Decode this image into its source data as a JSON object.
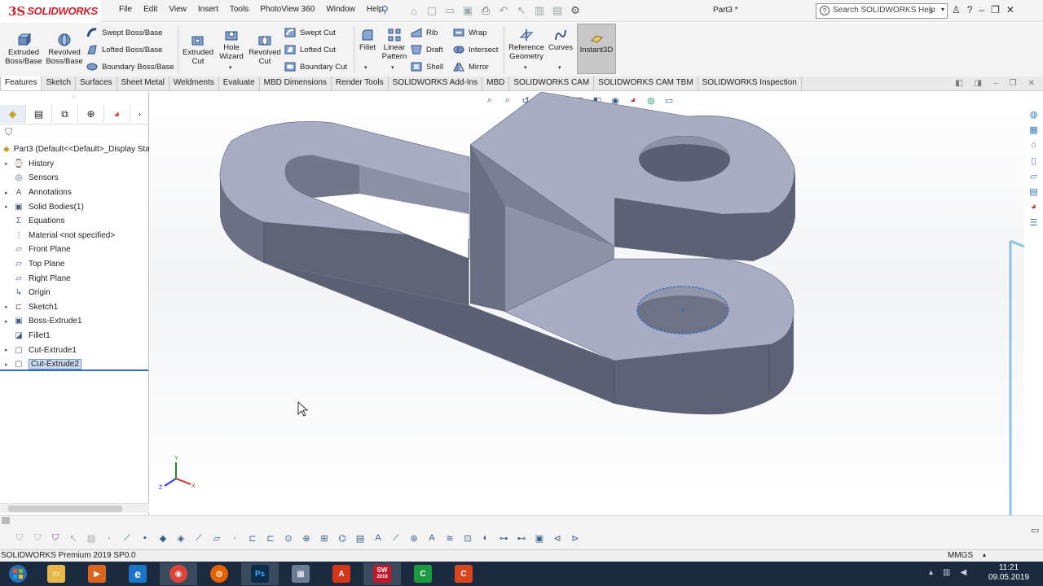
{
  "app": {
    "brand_prefix": "3S",
    "brand": "SOLIDWORKS",
    "doc_title": "Part3 *"
  },
  "menu": [
    "File",
    "Edit",
    "View",
    "Insert",
    "Tools",
    "PhotoView 360",
    "Window",
    "Help"
  ],
  "search": {
    "placeholder": "Search SOLIDWORKS Help"
  },
  "ribbon": {
    "extruded_boss": "Extruded Boss/Base",
    "revolved_boss": "Revolved Boss/Base",
    "swept_boss": "Swept Boss/Base",
    "lofted_boss": "Lofted Boss/Base",
    "boundary_boss": "Boundary Boss/Base",
    "extruded_cut": "Extruded Cut",
    "hole_wizard": "Hole Wizard",
    "revolved_cut": "Revolved Cut",
    "swept_cut": "Swept Cut",
    "lofted_cut": "Lofted Cut",
    "boundary_cut": "Boundary Cut",
    "fillet": "Fillet",
    "linear_pattern": "Linear Pattern",
    "rib": "Rib",
    "draft": "Draft",
    "shell": "Shell",
    "wrap": "Wrap",
    "intersect": "Intersect",
    "mirror": "Mirror",
    "reference_geometry": "Reference Geometry",
    "curves": "Curves",
    "instant3d": "Instant3D"
  },
  "tabs": [
    "Features",
    "Sketch",
    "Surfaces",
    "Sheet Metal",
    "Weldments",
    "Evaluate",
    "MBD Dimensions",
    "Render Tools",
    "SOLIDWORKS Add-Ins",
    "MBD",
    "SOLIDWORKS CAM",
    "SOLIDWORKS CAM TBM",
    "SOLIDWORKS Inspection"
  ],
  "active_tab": "Features",
  "tree": {
    "root": "Part3  (Default<<Default>_Display Sta",
    "items": [
      {
        "label": "History",
        "expandable": true
      },
      {
        "label": "Sensors",
        "expandable": false
      },
      {
        "label": "Annotations",
        "expandable": true
      },
      {
        "label": "Solid Bodies(1)",
        "expandable": true
      },
      {
        "label": "Equations",
        "expandable": false
      },
      {
        "label": "Material <not specified>",
        "expandable": false
      },
      {
        "label": "Front Plane",
        "expandable": false
      },
      {
        "label": "Top Plane",
        "expandable": false
      },
      {
        "label": "Right Plane",
        "expandable": false
      },
      {
        "label": "Origin",
        "expandable": false
      },
      {
        "label": "Sketch1",
        "expandable": true
      },
      {
        "label": "Boss-Extrude1",
        "expandable": true
      },
      {
        "label": "Fillet1",
        "expandable": false
      },
      {
        "label": "Cut-Extrude1",
        "expandable": true
      },
      {
        "label": "Cut-Extrude2",
        "expandable": true,
        "selected": true
      }
    ]
  },
  "axes": {
    "x": "X",
    "y": "Y",
    "z": "Z"
  },
  "status": {
    "version": "SOLIDWORKS Premium 2019 SP0.0",
    "units": "MMGS"
  },
  "taskbar": {
    "time": "11:21",
    "date": "09.05.2019",
    "sw_badge": "SW",
    "sw_year": "2019"
  },
  "colors": {
    "part_face": "#a8acc0",
    "part_side": "#5a5e72",
    "selection": "#2d6ebf",
    "brand": "#d3202c"
  }
}
